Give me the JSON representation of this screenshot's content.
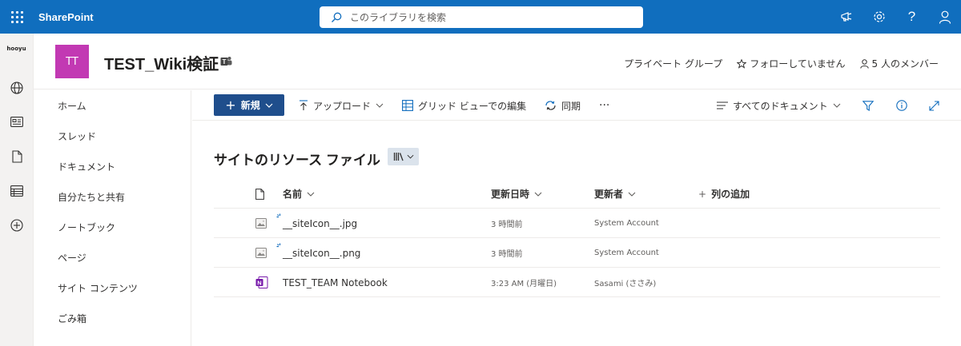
{
  "suite": {
    "app_name": "SharePoint",
    "search_placeholder": "このライブラリを検索"
  },
  "rail": {
    "logo_text": "hooyu"
  },
  "site": {
    "logo_initials": "TT",
    "logo_color": "#c239b3",
    "title": "TEST_Wiki検証",
    "privacy": "プライベート グループ",
    "follow": "フォローしていません",
    "members": "5 人のメンバー"
  },
  "nav": {
    "items": [
      "ホーム",
      "スレッド",
      "ドキュメント",
      "自分たちと共有",
      "ノートブック",
      "ページ",
      "サイト コンテンツ",
      "ごみ箱"
    ]
  },
  "commands": {
    "new": "新規",
    "upload": "アップロード",
    "grid_edit": "グリッド ビューでの編集",
    "sync": "同期",
    "more": "···",
    "view_name": "すべてのドキュメント"
  },
  "library": {
    "title": "サイトのリソース ファイル"
  },
  "table": {
    "columns": {
      "name": "名前",
      "modified": "更新日時",
      "modified_by": "更新者",
      "add_column": "列の追加"
    },
    "rows": [
      {
        "name": "__siteIcon__.jpg",
        "modified": "3 時間前",
        "modified_by": "System Account",
        "icon": "image-file-icon",
        "new": true
      },
      {
        "name": "__siteIcon__.png",
        "modified": "3 時間前",
        "modified_by": "System Account",
        "icon": "image-file-icon",
        "new": true
      },
      {
        "name": "TEST_TEAM Notebook",
        "modified": "3:23 AM (月曜日)",
        "modified_by": "Sasami (ささみ)",
        "icon": "onenote-icon",
        "new": false
      }
    ]
  },
  "colors": {
    "suite_bar": "#106ebe",
    "new_button": "#1f4e8c",
    "onenote": "#7719aa"
  }
}
